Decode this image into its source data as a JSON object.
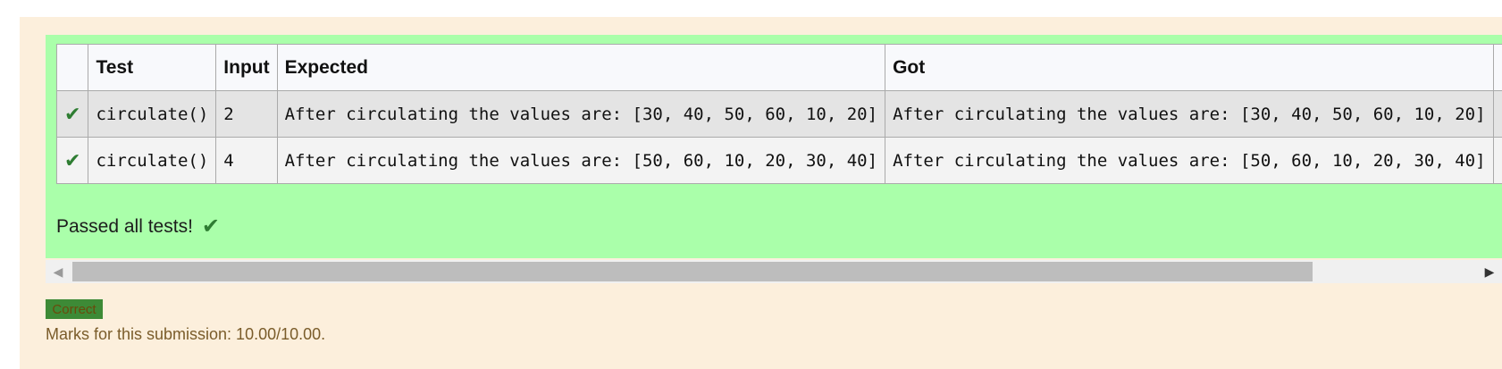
{
  "results_table": {
    "headers": [
      "",
      "Test",
      "Input",
      "Expected",
      "Got",
      ""
    ],
    "rows": [
      {
        "test": "circulate()",
        "input": "2",
        "expected": "After circulating the values are: [30, 40, 50, 60, 10, 20]",
        "got": "After circulating the values are: [30, 40, 50, 60, 10, 20]"
      },
      {
        "test": "circulate()",
        "input": "4",
        "expected": "After circulating the values are: [50, 60, 10, 20, 30, 40]",
        "got": "After circulating the values are: [50, 60, 10, 20, 30, 40]"
      }
    ]
  },
  "summary": {
    "passed_text": "Passed all tests!"
  },
  "status": {
    "badge": "Correct",
    "marks": "Marks for this submission: 10.00/10.00."
  },
  "icons": {
    "pass": "check-icon",
    "scroll_left": "scroll-left-arrow-icon",
    "scroll_right": "scroll-right-arrow-icon"
  },
  "colors": {
    "outcome_background": "#fcefdc",
    "feedback_background": "#aaffaa",
    "check_color": "#2e7d32",
    "badge_background": "#3d8a36"
  }
}
